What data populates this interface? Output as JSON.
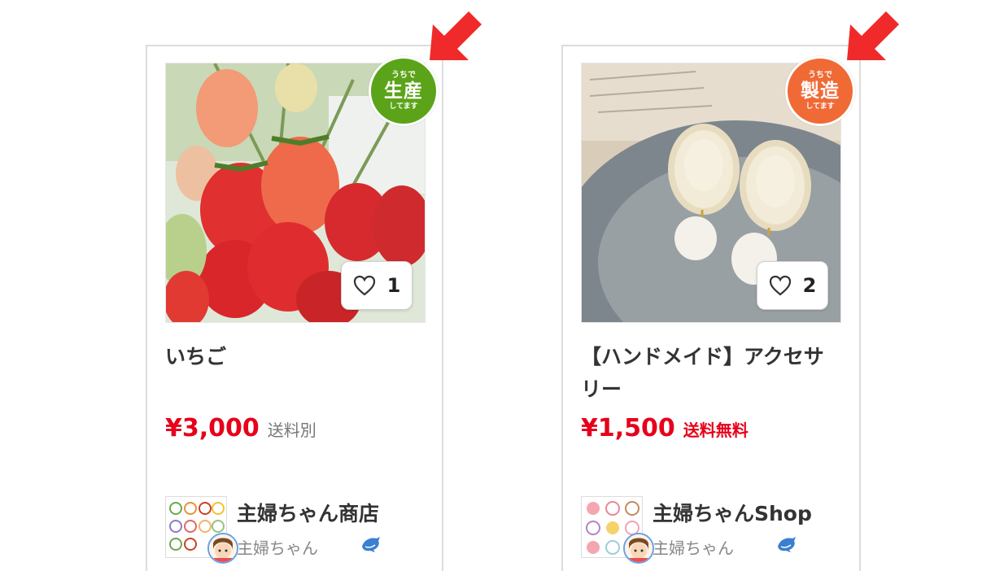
{
  "products": [
    {
      "badge": {
        "top": "うちで",
        "main": "生産",
        "bottom": "してます",
        "color": "#5ba419"
      },
      "like_count": "1",
      "title": "いちご",
      "price": "¥3,000",
      "shipping": "送料別",
      "shop_name": "主婦ちゃん商店",
      "owner": "主婦ちゃん"
    },
    {
      "badge": {
        "top": "うちで",
        "main": "製造",
        "bottom": "してます",
        "color": "#f06a35"
      },
      "like_count": "2",
      "title": "【ハンドメイド】アクセサリー",
      "price": "¥1,500",
      "shipping": "送料無料",
      "shop_name": "主婦ちゃんShop",
      "owner": "主婦ちゃん"
    }
  ],
  "colors": {
    "price": "#e6001a",
    "arrow": "#f02a2a",
    "border": "#dcdcdc"
  },
  "icons": [
    "red-arrow-icon",
    "heart-icon",
    "dolphin-icon"
  ]
}
